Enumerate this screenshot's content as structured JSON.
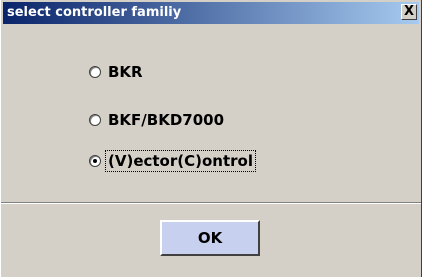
{
  "window": {
    "title": "select controller familiy",
    "close_label": "X"
  },
  "options": [
    {
      "label": "BKR",
      "selected": false
    },
    {
      "label": "BKF/BKD7000",
      "selected": false
    },
    {
      "label": "(V)ector(C)ontrol",
      "selected": true
    }
  ],
  "buttons": {
    "ok_label": "OK"
  },
  "colors": {
    "title_start": "#0a246a",
    "title_end": "#a6caf0",
    "dialog_bg": "#d4d0c8",
    "ok_bg": "#c8d0f0"
  }
}
